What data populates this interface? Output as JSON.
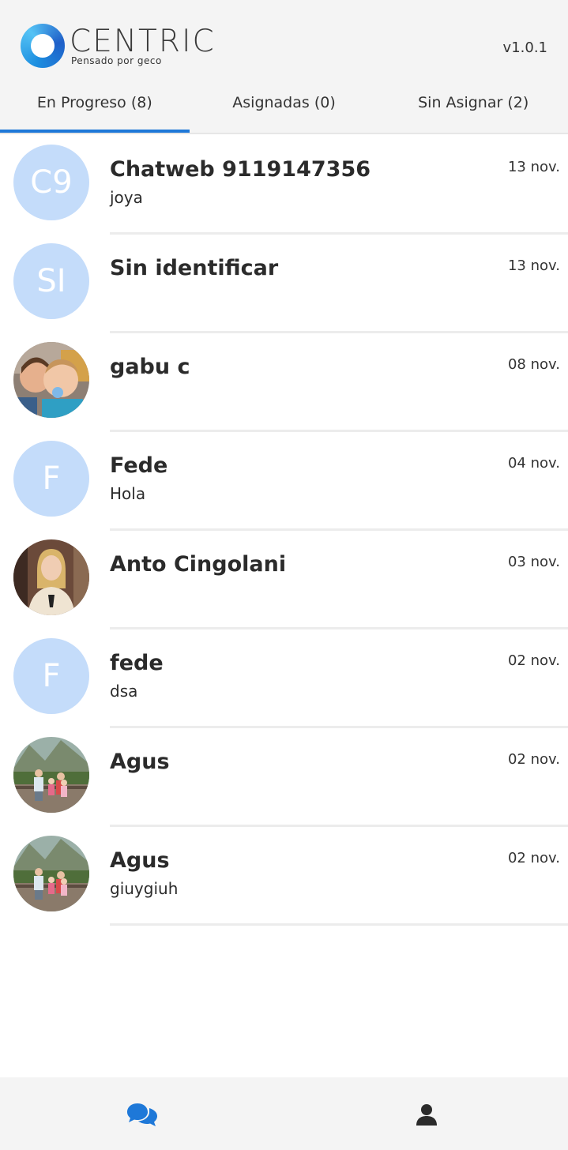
{
  "header": {
    "logo_text": "CENTRIC",
    "logo_subtitle": "Pensado por geco",
    "version": "v1.0.1"
  },
  "tabs": [
    {
      "label": "En Progreso (8)",
      "active": true
    },
    {
      "label": "Asignadas (0)",
      "active": false
    },
    {
      "label": "Sin Asignar (2)",
      "active": false
    }
  ],
  "conversations": [
    {
      "avatar_text": "C9",
      "name": "Chatweb 9119147356",
      "preview": "joya",
      "date": "13 nov."
    },
    {
      "avatar_text": "SI",
      "name": "Sin identificar",
      "preview": "",
      "date": "13 nov."
    },
    {
      "avatar_photo": "children-photo",
      "name": "gabu c",
      "preview": "",
      "date": "08 nov."
    },
    {
      "avatar_text": "F",
      "name": "Fede",
      "preview": "Hola",
      "date": "04 nov."
    },
    {
      "avatar_photo": "woman-photo",
      "name": "Anto Cingolani",
      "preview": "",
      "date": "03 nov."
    },
    {
      "avatar_text": "F",
      "name": "fede",
      "preview": "dsa",
      "date": "02 nov."
    },
    {
      "avatar_photo": "family-outdoor-photo",
      "name": "Agus",
      "preview": "",
      "date": "02 nov."
    },
    {
      "avatar_photo": "family-outdoor-photo",
      "name": "Agus",
      "preview": "giuygiuh",
      "date": "02 nov."
    }
  ],
  "bottom_nav": {
    "chats_icon": "chat-bubbles-icon",
    "profile_icon": "user-icon",
    "accent_color": "#1e78d8"
  }
}
